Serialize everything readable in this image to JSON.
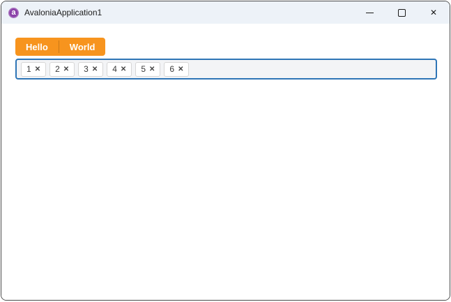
{
  "window": {
    "title": "AvaloniaApplication1",
    "controls": {
      "minimize_icon": "minimize",
      "maximize_icon": "maximize",
      "close_glyph": "✕"
    }
  },
  "app_icon": {
    "name": "avalonia-logo-icon",
    "letter": "a"
  },
  "tabs": [
    {
      "label": "Hello"
    },
    {
      "label": "World"
    }
  ],
  "tagbox": {
    "items": [
      {
        "label": "1",
        "close_glyph": "✕"
      },
      {
        "label": "2",
        "close_glyph": "✕"
      },
      {
        "label": "3",
        "close_glyph": "✕"
      },
      {
        "label": "4",
        "close_glyph": "✕"
      },
      {
        "label": "5",
        "close_glyph": "✕"
      },
      {
        "label": "6",
        "close_glyph": "✕"
      }
    ]
  },
  "colors": {
    "accent_orange": "#F7941E",
    "focus_border_blue": "#2E75B6",
    "titlebar_bg": "#EDF2F8",
    "window_border": "#4A4A4A",
    "logo_purple": "#8A41A8"
  }
}
